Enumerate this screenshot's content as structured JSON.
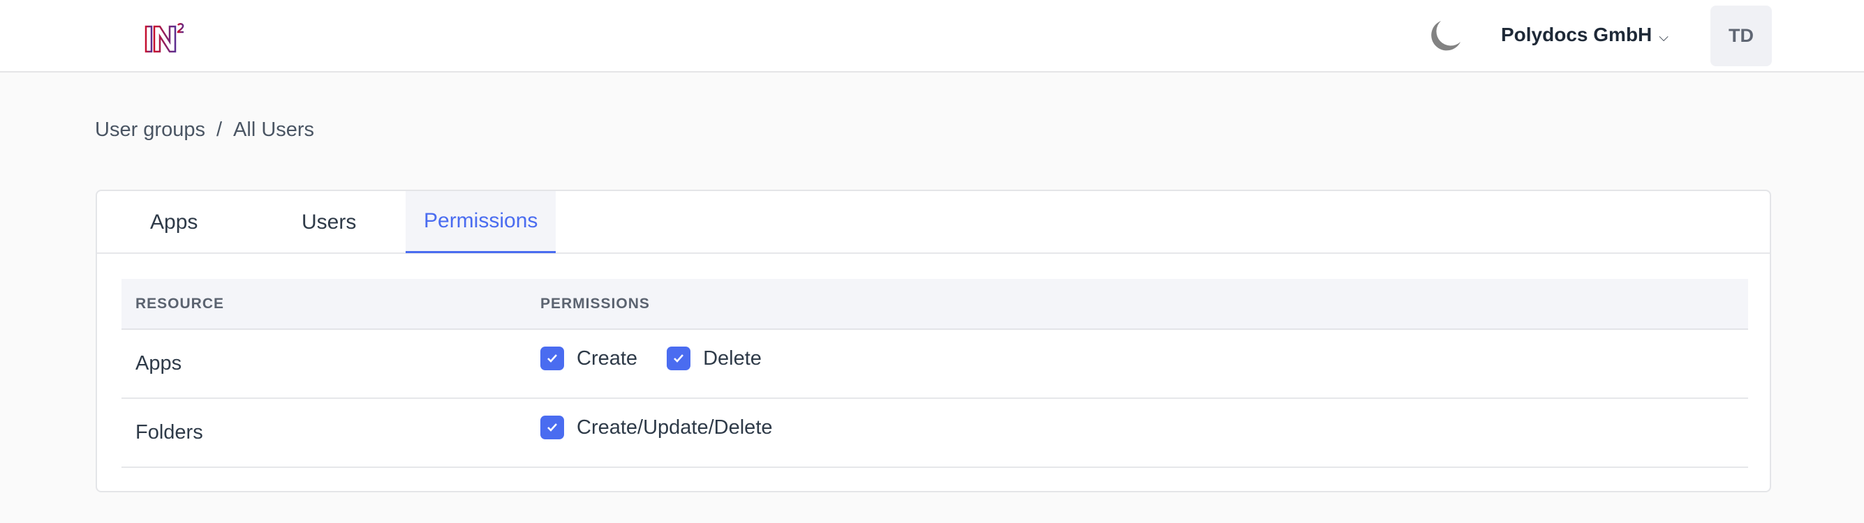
{
  "header": {
    "logo_text": "IN²",
    "org_name": "Polydocs GmbH",
    "avatar_initials": "TD",
    "theme_icon": "moon-icon"
  },
  "breadcrumb": {
    "items": [
      "User groups",
      "All Users"
    ],
    "separator": "/"
  },
  "tabs": [
    {
      "label": "Apps"
    },
    {
      "label": "Users"
    },
    {
      "label": "Permissions",
      "active": true
    }
  ],
  "table": {
    "headers": [
      "RESOURCE",
      "PERMISSIONS"
    ],
    "rows": [
      {
        "resource": "Apps",
        "permissions": [
          {
            "label": "Create",
            "checked": true
          },
          {
            "label": "Delete",
            "checked": true
          }
        ]
      },
      {
        "resource": "Folders",
        "permissions": [
          {
            "label": "Create/Update/Delete",
            "checked": true
          }
        ]
      }
    ]
  },
  "colors": {
    "accent": "#4a6cf0",
    "logo_start": "#c8102e",
    "logo_end": "#5b2d90"
  }
}
